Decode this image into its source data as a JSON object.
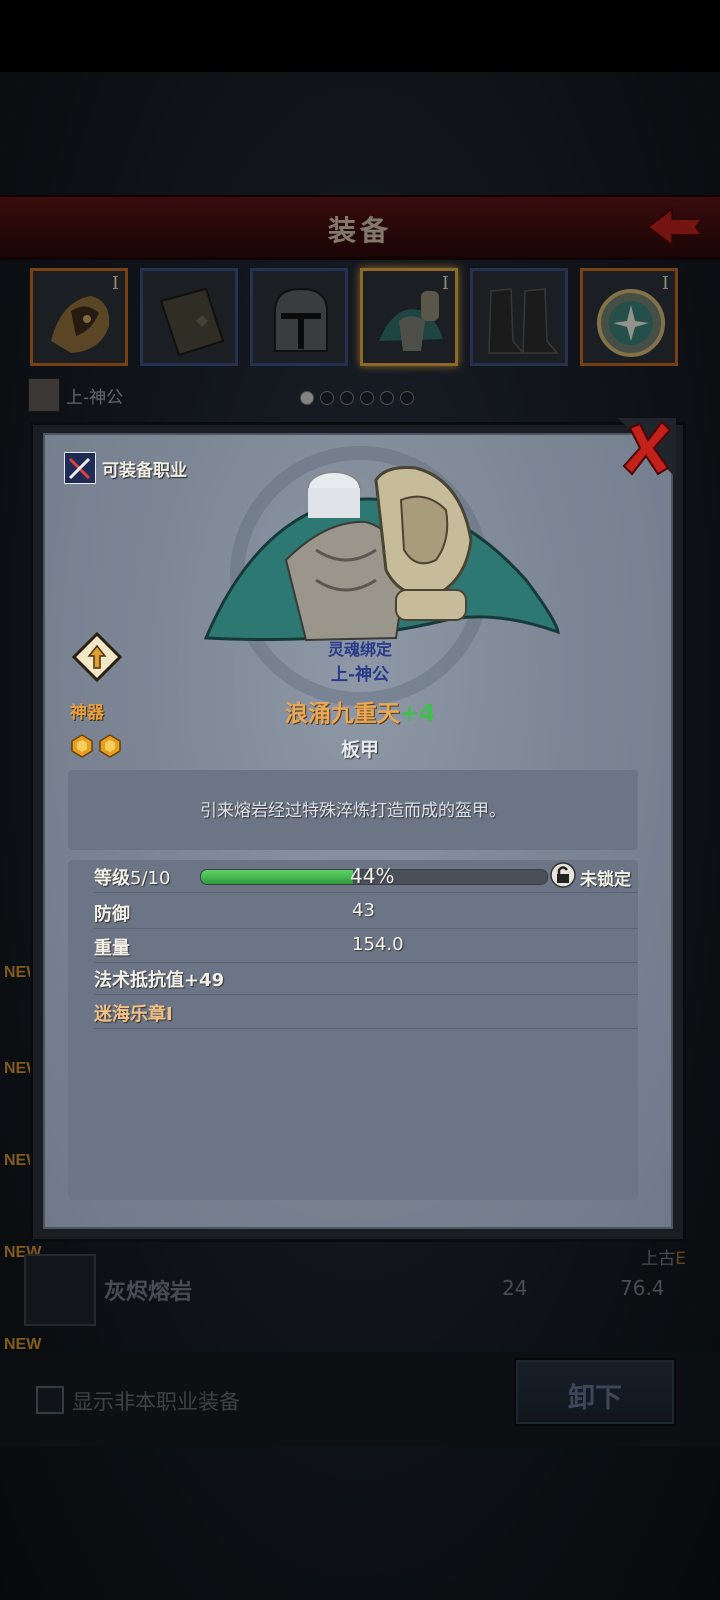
{
  "header": {
    "title": "装备"
  },
  "slots": [
    {
      "name": "helm-crest",
      "tier": "I",
      "frame": "orange"
    },
    {
      "name": "shield-slot",
      "tier": "",
      "frame": "blue"
    },
    {
      "name": "helmet",
      "tier": "",
      "frame": "blue"
    },
    {
      "name": "armor",
      "tier": "I",
      "frame": "active"
    },
    {
      "name": "boots",
      "tier": "",
      "frame": "blue"
    },
    {
      "name": "amulet",
      "tier": "I",
      "frame": "orange"
    }
  ],
  "character": {
    "name": "上-神公",
    "page_index": 0,
    "page_count": 6
  },
  "list": {
    "rows": [
      {
        "new_label": "NEW",
        "name": "灰烬熔岩",
        "val1": "24",
        "val2": "76.4",
        "grade_prefix": "上古",
        "grade": "E"
      }
    ],
    "new_labels": [
      "NEW",
      "NEW",
      "NEW",
      "NEW"
    ]
  },
  "bottom": {
    "show_other_class_label": "显示非本职业装备",
    "unequip_label": "卸下"
  },
  "modal": {
    "class_tag": "可装备职业",
    "soul_bound": "灵魂绑定",
    "owner": "上-神公",
    "rarity": "神器",
    "rarity_gems": 2,
    "item_name": "浪涌九重天",
    "item_plus": "+4",
    "item_type": "板甲",
    "description": "引来熔岩经过特殊淬炼打造而成的盔甲。",
    "stats": {
      "level_label": "等级",
      "level_value": "5/10",
      "exp_percent": 44,
      "exp_text": "44%",
      "lock_label": "未锁定",
      "defense_label": "防御",
      "defense_value": "43",
      "weight_label": "重量",
      "weight_value": "154.0",
      "magic_resist": "法术抵抗值+49",
      "set_name": "迷海乐章I"
    }
  },
  "colors": {
    "header_bg": "#5a1414",
    "exp_fill": "#3ec04a",
    "item_name": "#e8a858",
    "plus": "#3ec04a",
    "owner": "#2a3a8a"
  }
}
